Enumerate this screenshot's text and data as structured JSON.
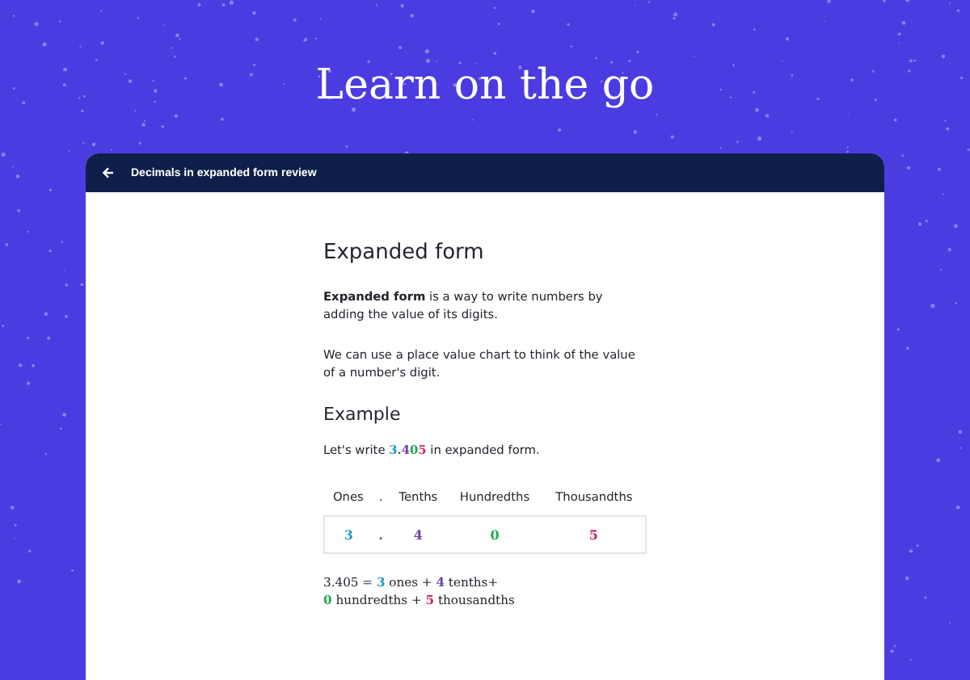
{
  "headline": "Learn on the go",
  "lesson": {
    "title": "Decimals in expanded form review",
    "heading": "Expanded form",
    "intro": "**Expanded form** is a way to write numbers by adding the value of its digits.",
    "note": "We can use a place value chart to think of the value of a number's digit.",
    "example_heading": "Example",
    "example": {
      "before": "Let's write ",
      "number": [
        {
          "text": "3",
          "color": "#1b9ec6"
        },
        {
          "text": ".",
          "color": "#555555"
        },
        {
          "text": "4",
          "color": "#6a3fb0"
        },
        {
          "text": "0",
          "color": "#1faa55"
        },
        {
          "text": "5",
          "color": "#d0216e"
        }
      ],
      "after": " in expanded form."
    },
    "table": {
      "columns": [
        "Ones",
        ".",
        "Tenths",
        "Hundredths",
        "Thousandths"
      ],
      "values": [
        {
          "text": "3",
          "color": "#1b9ec6"
        },
        {
          "text": ".",
          "color": "#555555"
        },
        {
          "text": "4",
          "color": "#6a3fb0"
        },
        {
          "text": "0",
          "color": "#1faa55"
        },
        {
          "text": "5",
          "color": "#d0216e"
        }
      ]
    },
    "equation": [
      [
        {
          "text": "3.405 = "
        },
        {
          "text": "3",
          "color": "#1b9ec6"
        },
        {
          "text": " ones + "
        },
        {
          "text": "4",
          "color": "#6a3fb0"
        },
        {
          "text": " tenths+"
        }
      ],
      [
        {
          "text": "0",
          "color": "#1faa55"
        },
        {
          "text": " hundredths + "
        },
        {
          "text": "5",
          "color": "#d0216e"
        },
        {
          "text": " thousandths"
        }
      ]
    ]
  }
}
